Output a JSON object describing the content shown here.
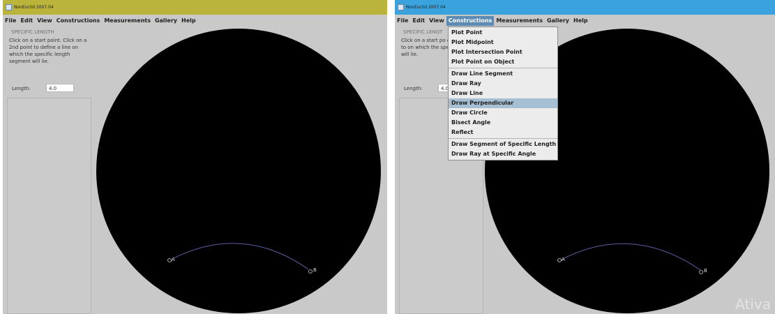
{
  "colors": {
    "titlebar_left": "#bbb43c",
    "titlebar_right": "#3aa2dc",
    "window_bg": "#c9c9c9",
    "canvas": "#000000",
    "arc": "#5a5f9e",
    "menu_highlight": "#5d8bb4",
    "dropdown_highlight": "#a7bfd2"
  },
  "left_window": {
    "title": "NonEuclid 2007.04",
    "menu": [
      "File",
      "Edit",
      "View",
      "Constructions",
      "Measurements",
      "Gallery",
      "Help"
    ],
    "panel": {
      "title": "SPECIFIC LENGTH",
      "description": "Click on a start point. Click on a 2nd point to define a line on which the specific length segment will lie.",
      "length_label": "Length:",
      "length_value": "4.0"
    },
    "points": {
      "a": "A",
      "b": "B"
    }
  },
  "right_window": {
    "title": "NonEuclid 2007.04",
    "menu": [
      "File",
      "Edit",
      "View",
      "Constructions",
      "Measurements",
      "Gallery",
      "Help"
    ],
    "active_menu": "Constructions",
    "panel": {
      "title": "SPECIFIC LENGT",
      "description": "Click on a start po on a 2nd point to on which the spec segment will lie.",
      "length_label": "Length:",
      "length_value": "4.0"
    },
    "dropdown": {
      "groups": [
        [
          "Plot Point",
          "Plot Midpoint",
          "Plot Intersection Point",
          "Plot Point on Object"
        ],
        [
          "Draw Line Segment",
          "Draw Ray",
          "Draw Line",
          "Draw Perpendicular",
          "Draw Circle",
          "Bisect Angle",
          "Reflect"
        ],
        [
          "Draw Segment of Specific Length",
          "Draw Ray at Specific Angle"
        ]
      ],
      "highlighted": "Draw Perpendicular"
    },
    "points": {
      "a": "A",
      "b": "B"
    },
    "watermark": "Ativa"
  }
}
